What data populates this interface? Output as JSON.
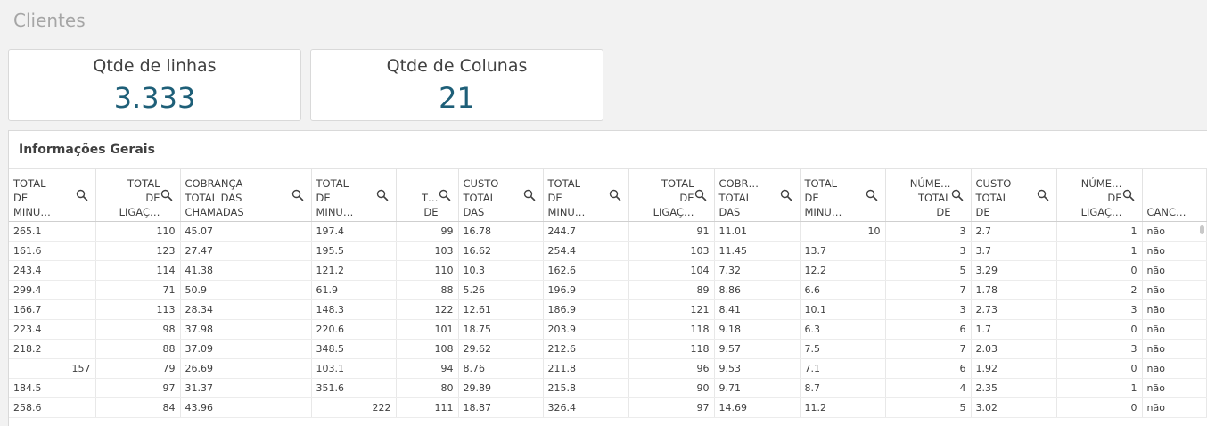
{
  "sheet": {
    "title": "Clientes"
  },
  "kpis": [
    {
      "label": "Qtde de linhas",
      "value": "3.333"
    },
    {
      "label": "Qtde de Colunas",
      "value": "21"
    }
  ],
  "table": {
    "title": "Informações Gerais",
    "columns": [
      {
        "label": "TOTAL\nDE\nMINU…",
        "align": "l",
        "search": true
      },
      {
        "label": "TOTAL\nDE\nLIGAÇ…",
        "align": "r",
        "search": true
      },
      {
        "label": "COBRANÇA\nTOTAL DAS\nCHAMADAS",
        "align": "l",
        "search": true
      },
      {
        "label": "TOTAL\nDE\nMINU…",
        "align": "l",
        "search": true
      },
      {
        "label": "T…\nDE",
        "align": "r",
        "search": true
      },
      {
        "label": "CUSTO\nTOTAL\nDAS",
        "align": "l",
        "search": true
      },
      {
        "label": "TOTAL\nDE\nMINU…",
        "align": "l",
        "search": true
      },
      {
        "label": "TOTAL\nDE\nLIGAÇ…",
        "align": "r",
        "search": true
      },
      {
        "label": "COBR…\nTOTAL\nDAS",
        "align": "l",
        "search": true
      },
      {
        "label": "TOTAL\nDE\nMINU…",
        "align": "l",
        "search": true
      },
      {
        "label": "NÚME…\nTOTAL\nDE",
        "align": "r",
        "search": true
      },
      {
        "label": "CUSTO\nTOTAL\nDE",
        "align": "l",
        "search": true
      },
      {
        "label": "NÚME…\nDE\nLIGAÇ…",
        "align": "r",
        "search": true
      },
      {
        "label": "CANC…",
        "align": "l",
        "search": false
      }
    ],
    "rows": [
      [
        {
          "v": "265.1",
          "a": "l"
        },
        {
          "v": "110",
          "a": "r"
        },
        {
          "v": "45.07",
          "a": "l"
        },
        {
          "v": "197.4",
          "a": "l"
        },
        {
          "v": "99",
          "a": "r"
        },
        {
          "v": "16.78",
          "a": "l"
        },
        {
          "v": "244.7",
          "a": "l"
        },
        {
          "v": "91",
          "a": "r"
        },
        {
          "v": "11.01",
          "a": "l"
        },
        {
          "v": "10",
          "a": "r"
        },
        {
          "v": "3",
          "a": "r"
        },
        {
          "v": "2.7",
          "a": "l"
        },
        {
          "v": "1",
          "a": "r"
        },
        {
          "v": "não",
          "a": "l"
        }
      ],
      [
        {
          "v": "161.6",
          "a": "l"
        },
        {
          "v": "123",
          "a": "r"
        },
        {
          "v": "27.47",
          "a": "l"
        },
        {
          "v": "195.5",
          "a": "l"
        },
        {
          "v": "103",
          "a": "r"
        },
        {
          "v": "16.62",
          "a": "l"
        },
        {
          "v": "254.4",
          "a": "l"
        },
        {
          "v": "103",
          "a": "r"
        },
        {
          "v": "11.45",
          "a": "l"
        },
        {
          "v": "13.7",
          "a": "l"
        },
        {
          "v": "3",
          "a": "r"
        },
        {
          "v": "3.7",
          "a": "l"
        },
        {
          "v": "1",
          "a": "r"
        },
        {
          "v": "não",
          "a": "l"
        }
      ],
      [
        {
          "v": "243.4",
          "a": "l"
        },
        {
          "v": "114",
          "a": "r"
        },
        {
          "v": "41.38",
          "a": "l"
        },
        {
          "v": "121.2",
          "a": "l"
        },
        {
          "v": "110",
          "a": "r"
        },
        {
          "v": "10.3",
          "a": "l"
        },
        {
          "v": "162.6",
          "a": "l"
        },
        {
          "v": "104",
          "a": "r"
        },
        {
          "v": "7.32",
          "a": "l"
        },
        {
          "v": "12.2",
          "a": "l"
        },
        {
          "v": "5",
          "a": "r"
        },
        {
          "v": "3.29",
          "a": "l"
        },
        {
          "v": "0",
          "a": "r"
        },
        {
          "v": "não",
          "a": "l"
        }
      ],
      [
        {
          "v": "299.4",
          "a": "l"
        },
        {
          "v": "71",
          "a": "r"
        },
        {
          "v": "50.9",
          "a": "l"
        },
        {
          "v": "61.9",
          "a": "l"
        },
        {
          "v": "88",
          "a": "r"
        },
        {
          "v": "5.26",
          "a": "l"
        },
        {
          "v": "196.9",
          "a": "l"
        },
        {
          "v": "89",
          "a": "r"
        },
        {
          "v": "8.86",
          "a": "l"
        },
        {
          "v": "6.6",
          "a": "l"
        },
        {
          "v": "7",
          "a": "r"
        },
        {
          "v": "1.78",
          "a": "l"
        },
        {
          "v": "2",
          "a": "r"
        },
        {
          "v": "não",
          "a": "l"
        }
      ],
      [
        {
          "v": "166.7",
          "a": "l"
        },
        {
          "v": "113",
          "a": "r"
        },
        {
          "v": "28.34",
          "a": "l"
        },
        {
          "v": "148.3",
          "a": "l"
        },
        {
          "v": "122",
          "a": "r"
        },
        {
          "v": "12.61",
          "a": "l"
        },
        {
          "v": "186.9",
          "a": "l"
        },
        {
          "v": "121",
          "a": "r"
        },
        {
          "v": "8.41",
          "a": "l"
        },
        {
          "v": "10.1",
          "a": "l"
        },
        {
          "v": "3",
          "a": "r"
        },
        {
          "v": "2.73",
          "a": "l"
        },
        {
          "v": "3",
          "a": "r"
        },
        {
          "v": "não",
          "a": "l"
        }
      ],
      [
        {
          "v": "223.4",
          "a": "l"
        },
        {
          "v": "98",
          "a": "r"
        },
        {
          "v": "37.98",
          "a": "l"
        },
        {
          "v": "220.6",
          "a": "l"
        },
        {
          "v": "101",
          "a": "r"
        },
        {
          "v": "18.75",
          "a": "l"
        },
        {
          "v": "203.9",
          "a": "l"
        },
        {
          "v": "118",
          "a": "r"
        },
        {
          "v": "9.18",
          "a": "l"
        },
        {
          "v": "6.3",
          "a": "l"
        },
        {
          "v": "6",
          "a": "r"
        },
        {
          "v": "1.7",
          "a": "l"
        },
        {
          "v": "0",
          "a": "r"
        },
        {
          "v": "não",
          "a": "l"
        }
      ],
      [
        {
          "v": "218.2",
          "a": "l"
        },
        {
          "v": "88",
          "a": "r"
        },
        {
          "v": "37.09",
          "a": "l"
        },
        {
          "v": "348.5",
          "a": "l"
        },
        {
          "v": "108",
          "a": "r"
        },
        {
          "v": "29.62",
          "a": "l"
        },
        {
          "v": "212.6",
          "a": "l"
        },
        {
          "v": "118",
          "a": "r"
        },
        {
          "v": "9.57",
          "a": "l"
        },
        {
          "v": "7.5",
          "a": "l"
        },
        {
          "v": "7",
          "a": "r"
        },
        {
          "v": "2.03",
          "a": "l"
        },
        {
          "v": "3",
          "a": "r"
        },
        {
          "v": "não",
          "a": "l"
        }
      ],
      [
        {
          "v": "157",
          "a": "r"
        },
        {
          "v": "79",
          "a": "r"
        },
        {
          "v": "26.69",
          "a": "l"
        },
        {
          "v": "103.1",
          "a": "l"
        },
        {
          "v": "94",
          "a": "r"
        },
        {
          "v": "8.76",
          "a": "l"
        },
        {
          "v": "211.8",
          "a": "l"
        },
        {
          "v": "96",
          "a": "r"
        },
        {
          "v": "9.53",
          "a": "l"
        },
        {
          "v": "7.1",
          "a": "l"
        },
        {
          "v": "6",
          "a": "r"
        },
        {
          "v": "1.92",
          "a": "l"
        },
        {
          "v": "0",
          "a": "r"
        },
        {
          "v": "não",
          "a": "l"
        }
      ],
      [
        {
          "v": "184.5",
          "a": "l"
        },
        {
          "v": "97",
          "a": "r"
        },
        {
          "v": "31.37",
          "a": "l"
        },
        {
          "v": "351.6",
          "a": "l"
        },
        {
          "v": "80",
          "a": "r"
        },
        {
          "v": "29.89",
          "a": "l"
        },
        {
          "v": "215.8",
          "a": "l"
        },
        {
          "v": "90",
          "a": "r"
        },
        {
          "v": "9.71",
          "a": "l"
        },
        {
          "v": "8.7",
          "a": "l"
        },
        {
          "v": "4",
          "a": "r"
        },
        {
          "v": "2.35",
          "a": "l"
        },
        {
          "v": "1",
          "a": "r"
        },
        {
          "v": "não",
          "a": "l"
        }
      ],
      [
        {
          "v": "258.6",
          "a": "l"
        },
        {
          "v": "84",
          "a": "r"
        },
        {
          "v": "43.96",
          "a": "l"
        },
        {
          "v": "222",
          "a": "r"
        },
        {
          "v": "111",
          "a": "r"
        },
        {
          "v": "18.87",
          "a": "l"
        },
        {
          "v": "326.4",
          "a": "l"
        },
        {
          "v": "97",
          "a": "r"
        },
        {
          "v": "14.69",
          "a": "l"
        },
        {
          "v": "11.2",
          "a": "l"
        },
        {
          "v": "5",
          "a": "r"
        },
        {
          "v": "3.02",
          "a": "l"
        },
        {
          "v": "0",
          "a": "r"
        },
        {
          "v": "não",
          "a": "l"
        }
      ]
    ]
  }
}
